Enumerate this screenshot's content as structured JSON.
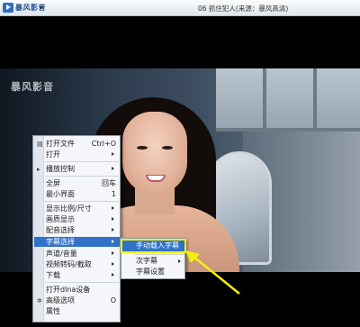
{
  "app": {
    "name": "暴风影音",
    "window_title": "06 抓住犯人(来源：暴风高清)"
  },
  "video": {
    "watermark": "暴风影音"
  },
  "context_menu": {
    "items": [
      {
        "label": "打开文件",
        "shortcut": "Ctrl+O",
        "icon": "folder-icon"
      },
      {
        "label": "打开",
        "submenu": true
      },
      {
        "label": "播放控制",
        "submenu": true,
        "icon": "play-icon"
      },
      {
        "label": "全屏",
        "shortcut": "回车"
      },
      {
        "label": "最小界面",
        "shortcut": "1"
      },
      {
        "label": "显示比例/尺寸",
        "submenu": true
      },
      {
        "label": "画质显示",
        "submenu": true
      },
      {
        "label": "配音选择",
        "submenu": true
      },
      {
        "label": "字幕选择",
        "submenu": true,
        "highlighted": true
      },
      {
        "label": "声道/音量",
        "submenu": true
      },
      {
        "label": "视频转码/截取",
        "submenu": true
      },
      {
        "label": "下载",
        "submenu": true
      },
      {
        "label": "打开dlna设备"
      },
      {
        "label": "高级选项",
        "shortcut": "O",
        "icon": "settings-icon"
      },
      {
        "label": "属性"
      }
    ]
  },
  "subtitle_submenu": {
    "items": [
      {
        "label": "手动载入字幕",
        "highlighted": true
      },
      {
        "label": "次字幕",
        "submenu": true
      },
      {
        "label": "字幕设置"
      }
    ]
  },
  "colors": {
    "highlight": "#2f72c7",
    "annotation": "#f3f00c"
  }
}
